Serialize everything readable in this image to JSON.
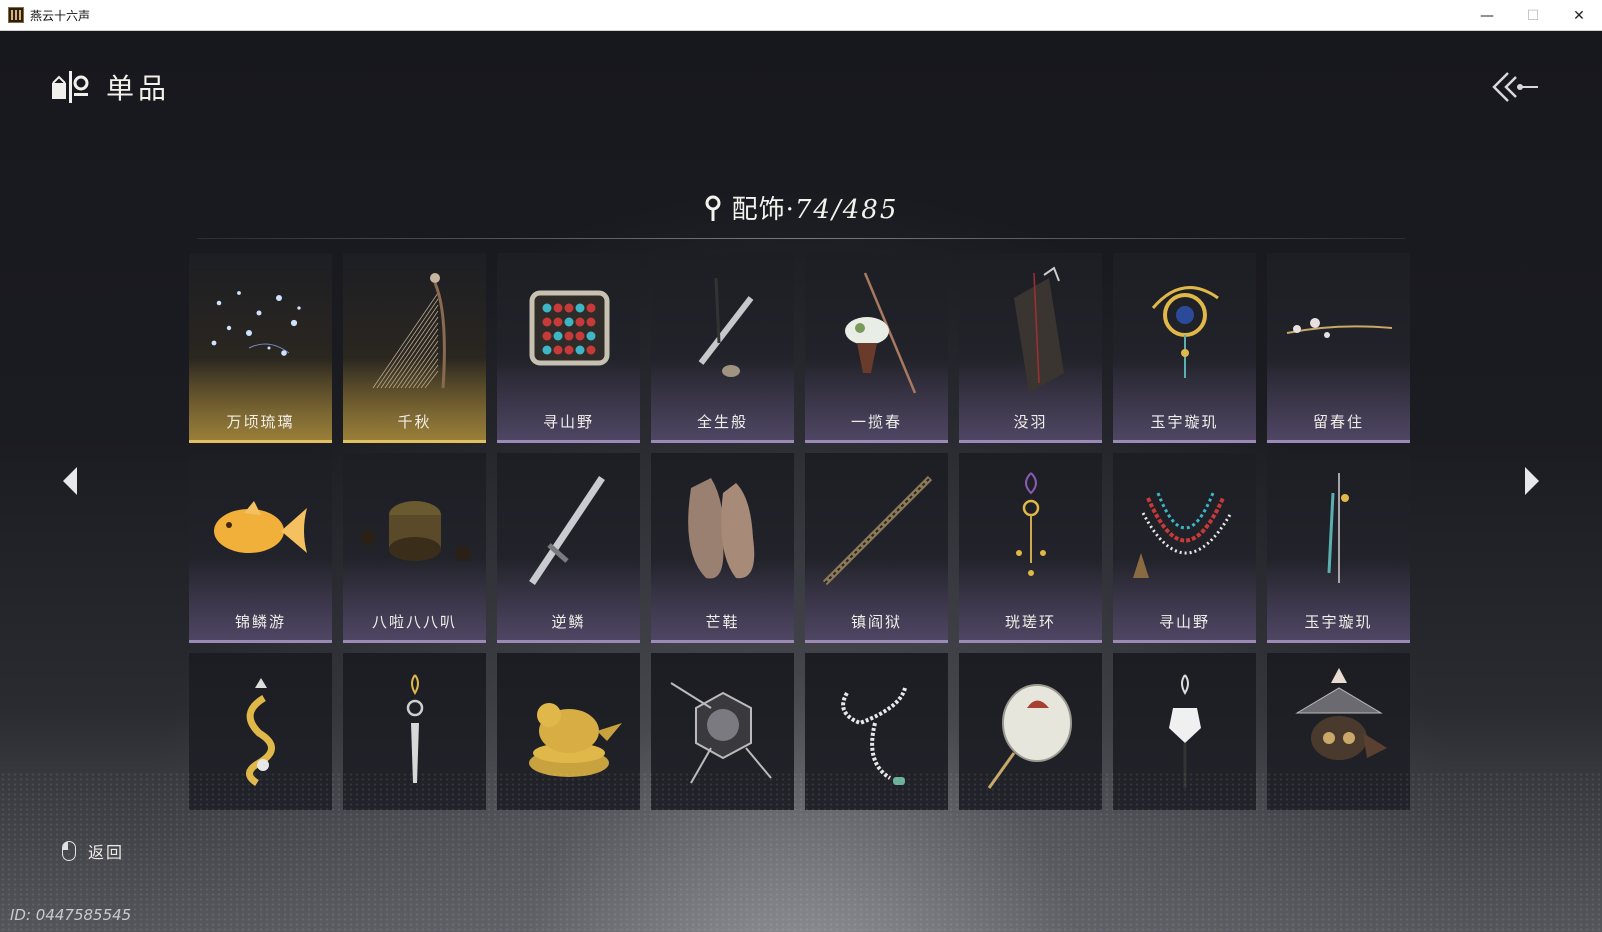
{
  "window": {
    "title": "燕云十六声",
    "minimize": "—",
    "maximize": "☐",
    "close": "✕"
  },
  "header": {
    "title": "单品",
    "icon": "collection-icon"
  },
  "section": {
    "name": "配饰",
    "separator": "·",
    "count": "74/485",
    "icon": "pin-icon"
  },
  "items": [
    {
      "label": "万顷琉璃",
      "art": "sparkles",
      "rarity": "gold"
    },
    {
      "label": "千秋",
      "art": "harp",
      "rarity": "gold"
    },
    {
      "label": "寻山野",
      "art": "abacus",
      "rarity": "purple"
    },
    {
      "label": "全生般",
      "art": "pipe",
      "rarity": "purple"
    },
    {
      "label": "一揽春",
      "art": "flowerstaff",
      "rarity": "purple"
    },
    {
      "label": "没羽",
      "art": "quiver",
      "rarity": "purple"
    },
    {
      "label": "玉宇璇玑",
      "art": "moon-ornament",
      "rarity": "purple"
    },
    {
      "label": "留春住",
      "art": "branch",
      "rarity": "purple"
    },
    {
      "label": "锦鳞游",
      "art": "goldfish",
      "rarity": "purple"
    },
    {
      "label": "八啦八八叭",
      "art": "drum",
      "rarity": "purple"
    },
    {
      "label": "逆鳞",
      "art": "sword",
      "rarity": "purple"
    },
    {
      "label": "芒鞋",
      "art": "sandals",
      "rarity": "purple"
    },
    {
      "label": "镇阎狱",
      "art": "staff",
      "rarity": "purple"
    },
    {
      "label": "珖瑳环",
      "art": "pendant",
      "rarity": "purple"
    },
    {
      "label": "寻山野",
      "art": "necklace",
      "rarity": "purple"
    },
    {
      "label": "玉宇璇玑",
      "art": "tassel",
      "rarity": "purple"
    },
    {
      "label": "",
      "art": "seahorse",
      "rarity": "plain"
    },
    {
      "label": "",
      "art": "pendant2",
      "rarity": "plain"
    },
    {
      "label": "",
      "art": "bird",
      "rarity": "plain"
    },
    {
      "label": "",
      "art": "compass",
      "rarity": "plain"
    },
    {
      "label": "",
      "art": "beads",
      "rarity": "plain"
    },
    {
      "label": "",
      "art": "fan",
      "rarity": "plain"
    },
    {
      "label": "",
      "art": "charm",
      "rarity": "plain"
    },
    {
      "label": "",
      "art": "lantern",
      "rarity": "plain"
    }
  ],
  "nav": {
    "prev": "left-arrow-icon",
    "next": "right-arrow-icon"
  },
  "footer": {
    "back_label": "返回",
    "user_id": "ID: 0447585545"
  },
  "colors": {
    "gold": "#e0c060",
    "purple": "#9a8ab5"
  }
}
